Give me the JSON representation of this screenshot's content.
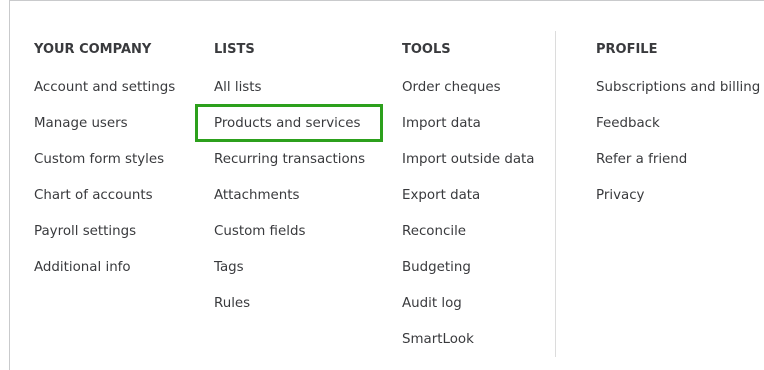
{
  "columns": {
    "company": {
      "heading": "YOUR COMPANY",
      "items": [
        "Account and settings",
        "Manage users",
        "Custom form styles",
        "Chart of accounts",
        "Payroll settings",
        "Additional info"
      ]
    },
    "lists": {
      "heading": "LISTS",
      "items": [
        "All lists",
        "Products and services",
        "Recurring transactions",
        "Attachments",
        "Custom fields",
        "Tags",
        "Rules"
      ]
    },
    "tools": {
      "heading": "TOOLS",
      "items": [
        "Order cheques",
        "Import data",
        "Import outside data",
        "Export data",
        "Reconcile",
        "Budgeting",
        "Audit log",
        "SmartLook"
      ]
    },
    "profile": {
      "heading": "PROFILE",
      "items": [
        "Subscriptions and billing",
        "Feedback",
        "Refer a friend",
        "Privacy"
      ]
    }
  },
  "highlight": {
    "item": "Products and services",
    "color": "#2ca01c"
  }
}
